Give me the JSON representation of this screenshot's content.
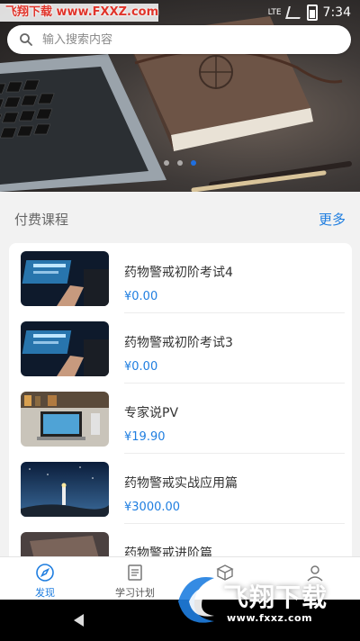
{
  "status_bar": {
    "watermark": "飞翔下载 www.FXXZ.com",
    "network": "LTE",
    "time": "7:34"
  },
  "search": {
    "placeholder": "输入搜索内容",
    "icon": "search-icon"
  },
  "banner": {
    "page_count": 3,
    "active_page": 3
  },
  "section": {
    "title": "付费课程",
    "more_label": "更多"
  },
  "courses": [
    {
      "title": "药物警戒初阶考试4",
      "price": "¥0.00"
    },
    {
      "title": "药物警戒初阶考试3",
      "price": "¥0.00"
    },
    {
      "title": "专家说PV",
      "price": "¥19.90"
    },
    {
      "title": "药物警戒实战应用篇",
      "price": "¥3000.00"
    },
    {
      "title": "药物警戒进阶篇",
      "price": ""
    }
  ],
  "tabs": [
    {
      "label": "发现",
      "icon": "compass-icon",
      "active": true
    },
    {
      "label": "学习计划",
      "icon": "plan-list-icon",
      "active": false
    },
    {
      "label": "",
      "icon": "box-icon",
      "active": false
    },
    {
      "label": "",
      "icon": "user-icon",
      "active": false
    }
  ],
  "promo_badge": {
    "name": "飞翔下载",
    "url": "www.fxxz.com"
  },
  "colors": {
    "accent": "#1f7ee0",
    "watermark_red": "#e0352b"
  }
}
